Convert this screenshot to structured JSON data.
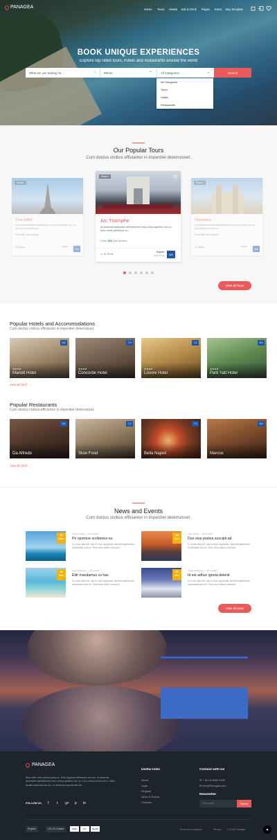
{
  "nav": {
    "brand": "PANAGEA",
    "items": [
      "Home",
      "Tours",
      "Hotels",
      "Eat & Drink",
      "Pages",
      "Extra",
      "Buy template"
    ]
  },
  "hero": {
    "title": "BOOK UNIQUE EXPERIENCES",
    "subtitle": "Explore top rated tours, hotels and restaurants around the world",
    "search_placeholder": "What are you looking for...",
    "where_placeholder": "Where",
    "category_value": "All Categories",
    "search_button": "Search",
    "dropdown_options": [
      "All Categories",
      "Tours",
      "Hotels",
      "Restaurants"
    ]
  },
  "tours": {
    "title": "Our Popular Tours",
    "subtitle": "Cum doctus civibus efficiantur in imperdiet deterruisset.",
    "cards": [
      {
        "badge": "Historic",
        "name": "Tour Eiffel",
        "desc": "Id placerat tacimates definitionem sea prima quidem vim no. Duo nobis persecuti cu.",
        "price": "From $54 /per person",
        "duration": "1h 30min",
        "rating_label": "Superb",
        "reviews": "350 Reviews",
        "score": "9.0"
      },
      {
        "badge": "Historic",
        "name": "Arc Triomphe",
        "desc": "Id placerat tacimates definitionem sea prima quidem vim no. Duo nobis persecuti cu.",
        "price_prefix": "From",
        "price": "$54",
        "price_suffix": "/per person",
        "duration": "1h 30min",
        "rating_label": "Superb",
        "reviews": "350 Reviews",
        "score": "9.0"
      },
      {
        "badge": "Historic",
        "name": "Notredam",
        "desc": "Id placerat tacimates definitionem sea prima quidem vim no. Duo nobis persecuti cu.",
        "price": "From $54 /per person",
        "duration": "1h 30min",
        "rating_label": "Superb",
        "reviews": "350 Reviews",
        "score": "9.0"
      }
    ],
    "view_all": "View all Tours"
  },
  "hotels": {
    "title": "Popular Hotels and Accommodations",
    "subtitle": "Cum doctus civibus efficiantur in imperdiet deterruisset.",
    "items": [
      {
        "name": "Mariott Hotel",
        "score": "8.9"
      },
      {
        "name": "Concorde Hotel",
        "score": "7.0"
      },
      {
        "name": "Louvre Hotel",
        "score": "7.0"
      },
      {
        "name": "Park Yatt Hotel",
        "score": "8.9"
      }
    ],
    "stars": "★★★★",
    "view_all": "View all (157)"
  },
  "restaurants": {
    "title": "Popular Restaurants",
    "subtitle": "Cum doctus civibus efficiantur in imperdiet deterruisset.",
    "items": [
      {
        "name": "Da Alfredo",
        "score": "8.9"
      },
      {
        "name": "Slow Food",
        "score": "7.0"
      },
      {
        "name": "Bella Napoli",
        "score": "7.0"
      },
      {
        "name": "Marcus",
        "score": "8.9"
      }
    ],
    "view_all": "View all (157)"
  },
  "news": {
    "title": "News and Events",
    "subtitle": "Cum doctus civibus efficiantur in imperdiet deterruisset.",
    "items": [
      {
        "day": "28",
        "month": "Dec",
        "meta": "Admin Travel — 20.11.2017",
        "title": "Pri oportere scribentur eu",
        "text": "Cu eum alia elit, usu in eius appareat, deleniti sapientem honestatis eos ex. Eum eius alium volumus."
      },
      {
        "day": "28",
        "month": "Dec",
        "meta": "Luke Sandy — 20.11.2017",
        "title": "Duo eius postea suscipit ad",
        "text": "Cu eum alia elit, usu in eius appareat, deleniti sapientem honestatis eos ex. Eum eius alium volumus."
      },
      {
        "day": "28",
        "month": "Dec",
        "meta": "Luca Robinson — 20.11.2017",
        "title": "Elitr mandamus cu has",
        "text": "Cu eum alia elit, usu in eius appareat, deleniti sapientem honestatis eos ex. Eum eius alium volumus."
      },
      {
        "day": "28",
        "month": "Dec",
        "meta": "Paula Rodrigues — 20.11.2017",
        "title": "Id est adhuc ignota delenit",
        "text": "Cu eum alia elit, usu in eius appareat, deleniti sapientem honestatis eos ex. Eum eius alium volumus."
      }
    ],
    "view_all": "View all news"
  },
  "footer": {
    "brand": "PANAGEA",
    "about": "Mea nibh meis philosophia eu. Duis legimus efficiantur ea sea. Id placerat tacimates definitionem sea, prima quidem vim no. Duo nobis persecuti cu. Nihil facilisi indoctum an vix, ut delectus expetendis vis.",
    "follow": "FOLLOW US",
    "social": [
      "f",
      "t",
      "g+",
      "p",
      "in"
    ],
    "useful_title": "Useful links",
    "useful": [
      "About",
      "Login",
      "Register",
      "News & Events",
      "Contacts"
    ],
    "contact_title": "Contact with Us",
    "phone": "+ 61 23 8093 3400",
    "email": "info@Panagea.com",
    "newsletter_title": "Newsletter",
    "newsletter_placeholder": "Your email",
    "newsletter_button": "Submit",
    "language": "English",
    "currency": "US Dollars",
    "cards": [
      "VISA",
      "MC",
      "PayPal"
    ],
    "legal": [
      "Terms and conditions",
      "Privacy",
      "© 2018 Panagea"
    ]
  },
  "colors": {
    "accent": "#e95a5a",
    "score": "#1f56a8",
    "date_badge": "#f3b30d",
    "footer_bg": "#1d242c"
  }
}
